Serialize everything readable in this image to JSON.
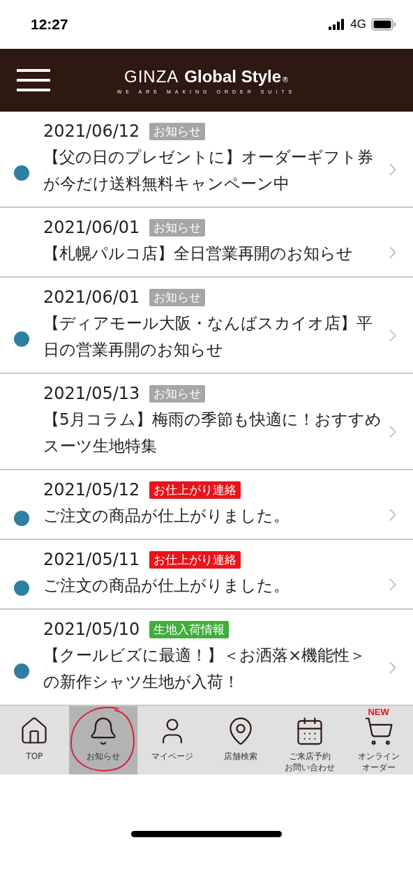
{
  "status_bar": {
    "time": "12:27",
    "network": "4G"
  },
  "header": {
    "logo": {
      "light": "GINZA",
      "bold": "Global Style",
      "mark": "®",
      "tagline": "WE ARE MAKING ORDER SUITS"
    }
  },
  "news": [
    {
      "date": "2021/06/12",
      "tag": "お知らせ",
      "color": "#a6a6a6",
      "title": "【父の日のプレゼントに】オーダーギフト券が今だけ送料無料キャンペーン中",
      "unread": true
    },
    {
      "date": "2021/06/01",
      "tag": "お知らせ",
      "color": "#a6a6a6",
      "title": "【札幌パルコ店】全日営業再開のお知らせ",
      "unread": false
    },
    {
      "date": "2021/06/01",
      "tag": "お知らせ",
      "color": "#a6a6a6",
      "title": "【ディアモール大阪・なんばスカイオ店】平日の営業再開のお知らせ",
      "unread": true
    },
    {
      "date": "2021/05/13",
      "tag": "お知らせ",
      "color": "#a6a6a6",
      "title": "【5月コラム】梅雨の季節も快適に！おすすめスーツ生地特集",
      "unread": false
    },
    {
      "date": "2021/05/12",
      "tag": "お仕上がり連絡",
      "color": "#e8141b",
      "title": "ご注文の商品が仕上がりました。",
      "unread": true
    },
    {
      "date": "2021/05/11",
      "tag": "お仕上がり連絡",
      "color": "#e8141b",
      "title": "ご注文の商品が仕上がりました。",
      "unread": true
    },
    {
      "date": "2021/05/10",
      "tag": "生地入荷情報",
      "color": "#3fae3a",
      "title": "【クールビズに最適！】＜お洒落×機能性＞の新作シャツ生地が入荷！",
      "unread": true
    }
  ],
  "tab_bar": [
    {
      "kind": "home",
      "label": "TOP",
      "selected": false
    },
    {
      "kind": "bell",
      "label": "お知らせ",
      "selected": true
    },
    {
      "kind": "person",
      "label": "マイページ",
      "selected": false
    },
    {
      "kind": "pin",
      "label": "店舗検索",
      "selected": false
    },
    {
      "kind": "calendar",
      "label": [
        "ご来店予約",
        "お問い合わせ"
      ],
      "selected": false
    },
    {
      "kind": "cart",
      "label": [
        "オンライン",
        "オーダー"
      ],
      "selected": false,
      "badge": "NEW"
    }
  ]
}
